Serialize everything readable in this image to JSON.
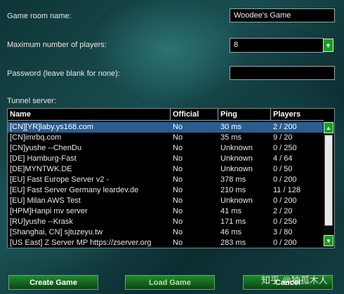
{
  "form": {
    "room_name_label": "Game room name:",
    "room_name_value": "Woodee's Game",
    "max_players_label": "Maximum number of players:",
    "max_players_value": "8",
    "password_label": "Password (leave blank for none):",
    "password_value": "",
    "tunnel_label": "Tunnel server:"
  },
  "table": {
    "columns": [
      "Name",
      "Official",
      "Ping",
      "Players"
    ],
    "rows": [
      {
        "name": "[CN][YR]laby.ys168.com",
        "official": "No",
        "ping": "30 ms",
        "players": "2 / 200"
      },
      {
        "name": "[CN]imrbq.com",
        "official": "No",
        "ping": "35 ms",
        "players": "9 / 20"
      },
      {
        "name": "[CN]yushe --ChenDu",
        "official": "No",
        "ping": "Unknown",
        "players": "0 / 250"
      },
      {
        "name": "[DE] Hamburg-Fast",
        "official": "No",
        "ping": "Unknown",
        "players": "4 / 64"
      },
      {
        "name": "[DE]MYNTWK.DE",
        "official": "No",
        "ping": "Unknown",
        "players": "0 / 50"
      },
      {
        "name": "[EU] Fast Europe Server v2 -",
        "official": "No",
        "ping": "378 ms",
        "players": "0 / 200"
      },
      {
        "name": "[EU] Fast Server Germany leardev.de",
        "official": "No",
        "ping": "210 ms",
        "players": "11 / 128"
      },
      {
        "name": "[EU] Milan AWS Test",
        "official": "No",
        "ping": "Unknown",
        "players": "0 / 200"
      },
      {
        "name": "[HPM]Hanpi mv server",
        "official": "No",
        "ping": "41 ms",
        "players": "2 / 20"
      },
      {
        "name": "[RU]yushe --Krask",
        "official": "No",
        "ping": "171 ms",
        "players": "0 / 250"
      },
      {
        "name": "[Shanghai, CN] sjtuzeyu.tw",
        "official": "No",
        "ping": "46 ms",
        "players": "3 / 80"
      },
      {
        "name": "[US East] Z Server MP https://zserver.org",
        "official": "No",
        "ping": "283 ms",
        "players": "0 / 200"
      }
    ],
    "selected_index": 0
  },
  "buttons": {
    "create": "Create Game",
    "load": "Load Game",
    "cancel": "Cancel"
  },
  "watermark": "知乎 @独孤木人",
  "colors": {
    "accent_green": "#1a9a2a",
    "selection_blue": "#2a5d8f",
    "create_text": "#ffffff",
    "load_text": "#b8e0a0",
    "cancel_text": "#ffffff"
  }
}
